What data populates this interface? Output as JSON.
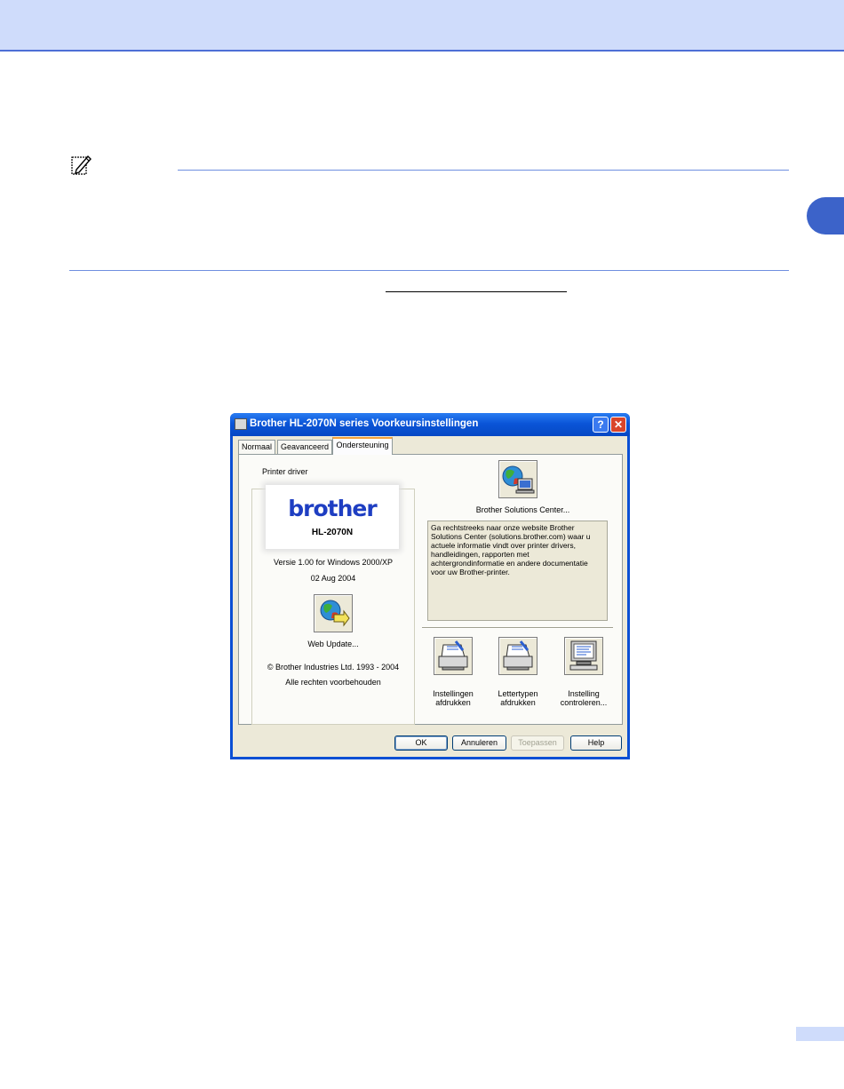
{
  "dialog": {
    "title": "Brother HL-2070N series Voorkeursinstellingen",
    "help_button": "?",
    "close_button": "✕",
    "tabs": [
      {
        "label": "Normaal"
      },
      {
        "label": "Geavanceerd"
      },
      {
        "label": "Ondersteuning"
      }
    ],
    "driver": {
      "group_label": "Printer driver",
      "logo_text": "brother",
      "model": "HL-2070N",
      "version": "Versie 1.00 for Windows 2000/XP",
      "date": "02 Aug 2004",
      "web_update_label": "Web Update...",
      "copyright": "© Brother Industries Ltd. 1993 - 2004",
      "rights": "Alle rechten voorbehouden"
    },
    "solutions": {
      "label": "Brother Solutions Center...",
      "description": "Ga rechtstreeks naar onze website Brother Solutions Center (solutions.brother.com) waar u actuele informatie vindt over printer drivers, handleidingen, rapporten met achtergrondinformatie en andere documentatie voor uw Brother-printer."
    },
    "tools": [
      {
        "line1": "Instellingen",
        "line2": "afdrukken",
        "icon": "printer-icon"
      },
      {
        "line1": "Lettertypen",
        "line2": "afdrukken",
        "icon": "printer-icon"
      },
      {
        "line1": "Instelling",
        "line2": "controleren...",
        "icon": "monitor-icon"
      }
    ],
    "buttons": {
      "ok": "OK",
      "cancel": "Annuleren",
      "apply": "Toepassen",
      "help": "Help"
    }
  },
  "colors": {
    "header_band": "#cfdcfb",
    "accent": "#3c63c9",
    "titlebar": "#0a55d8",
    "dialog_face": "#ece9d8"
  }
}
